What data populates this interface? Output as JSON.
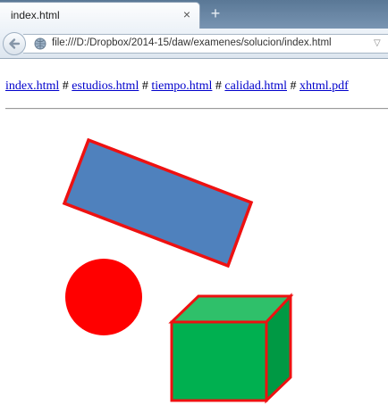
{
  "browser": {
    "tab_title": "index.html",
    "tab_close": "×",
    "new_tab": "+",
    "url": "file:///D:/Dropbox/2014-15/daw/examenes/solucion/index.html",
    "url_dropdown": "▽"
  },
  "page": {
    "links": [
      {
        "label": "index.html"
      },
      {
        "label": "estudios.html"
      },
      {
        "label": "tiempo.html"
      },
      {
        "label": "calidad.html"
      },
      {
        "label": "xhtml.pdf"
      }
    ],
    "separator": "#"
  },
  "colors": {
    "rectangle_fill": "#4f81bd",
    "outline": "#ee1111",
    "circle_fill": "#ff0000",
    "cube_front": "#00b050",
    "cube_top": "#2fc06a",
    "cube_side": "#009944"
  },
  "icons": {
    "back": "back-arrow-icon",
    "site": "globe-icon"
  }
}
